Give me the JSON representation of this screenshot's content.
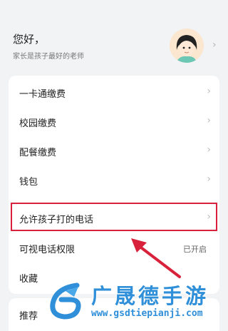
{
  "profile": {
    "greeting": "您好，",
    "subtitle": "家长是孩子最好的老师"
  },
  "menu": {
    "items": [
      {
        "label": "一卡通缴费"
      },
      {
        "label": "校园缴费"
      },
      {
        "label": "配餐缴费"
      },
      {
        "label": "钱包"
      },
      {
        "label": "允许孩子打的电话"
      },
      {
        "label": "可视电话权限",
        "status": "已开启"
      },
      {
        "label": "收藏"
      }
    ]
  },
  "bottom": {
    "label": "推荐"
  },
  "watermark": {
    "title": "广晟德手游",
    "url": "www.gsdtiepianji.com"
  },
  "colors": {
    "highlight": "#d8213a",
    "watermark": "#2f8fd8"
  },
  "icons": {
    "avatar": "teacher-avatar",
    "chevron": "chevron-right-icon",
    "arrow": "annotation-arrow"
  }
}
